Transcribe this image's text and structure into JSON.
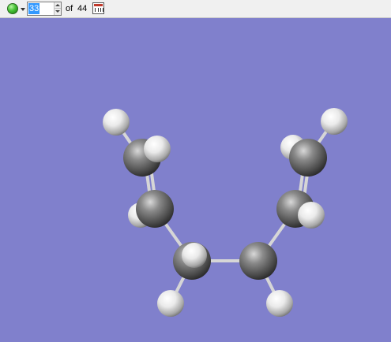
{
  "toolbar": {
    "status_icon": "green-circle-icon",
    "current_frame": "33",
    "of_label": "of",
    "total_frames": "44",
    "animation_icon": "animation-icon"
  },
  "viewport": {
    "background_color": "#8080cc",
    "carbon_color": "#5a5a5a",
    "hydrogen_color": "#e8e8e8",
    "bond_color": "#d8d8d8"
  }
}
